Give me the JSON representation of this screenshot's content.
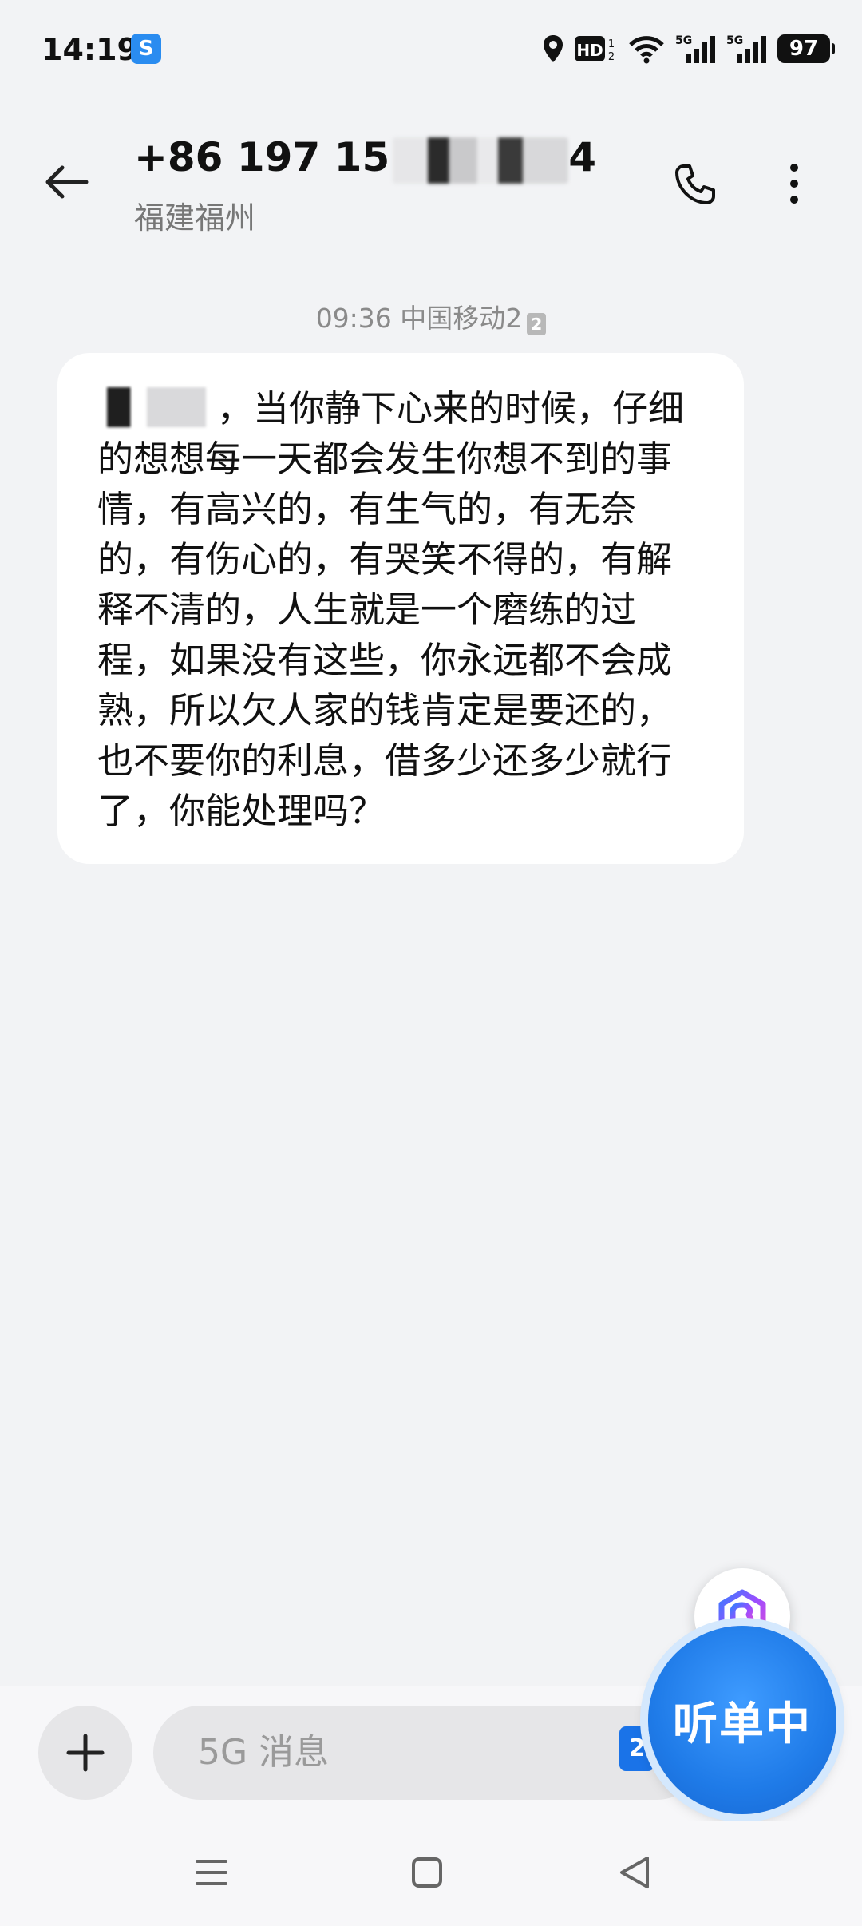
{
  "status_bar": {
    "time": "14:19",
    "battery": "97",
    "network_1": "5G",
    "network_2": "5G",
    "hd_label": "HD",
    "icons": [
      "app-notification-icon",
      "location-icon",
      "hd-icon",
      "wifi-icon",
      "signal-icon",
      "signal-icon",
      "battery-icon"
    ]
  },
  "header": {
    "number_visible": "+86 197 15",
    "number_suffix": "4",
    "location": "福建福州"
  },
  "message": {
    "time": "09:36",
    "carrier": "中国移动2",
    "sim_badge": "2",
    "body": "，当你静下心来的时候，仔细的想想每一天都会发生你想不到的事情，有高兴的，有生气的，有无奈的，有伤心的，有哭笑不得的，有解释不清的，人生就是一个磨练的过程，如果没有这些，你永远都不会成熟，所以欠人家的钱肯定是要还的，也不要你的利息，借多少还多少就行了，你能处理吗？"
  },
  "composer": {
    "placeholder": "5G 消息",
    "sim_select": "2"
  },
  "widget": {
    "listening_label": "听单中"
  },
  "colors": {
    "background": "#f2f3f5",
    "bubble": "#ffffff",
    "accent": "#1f7be8"
  }
}
